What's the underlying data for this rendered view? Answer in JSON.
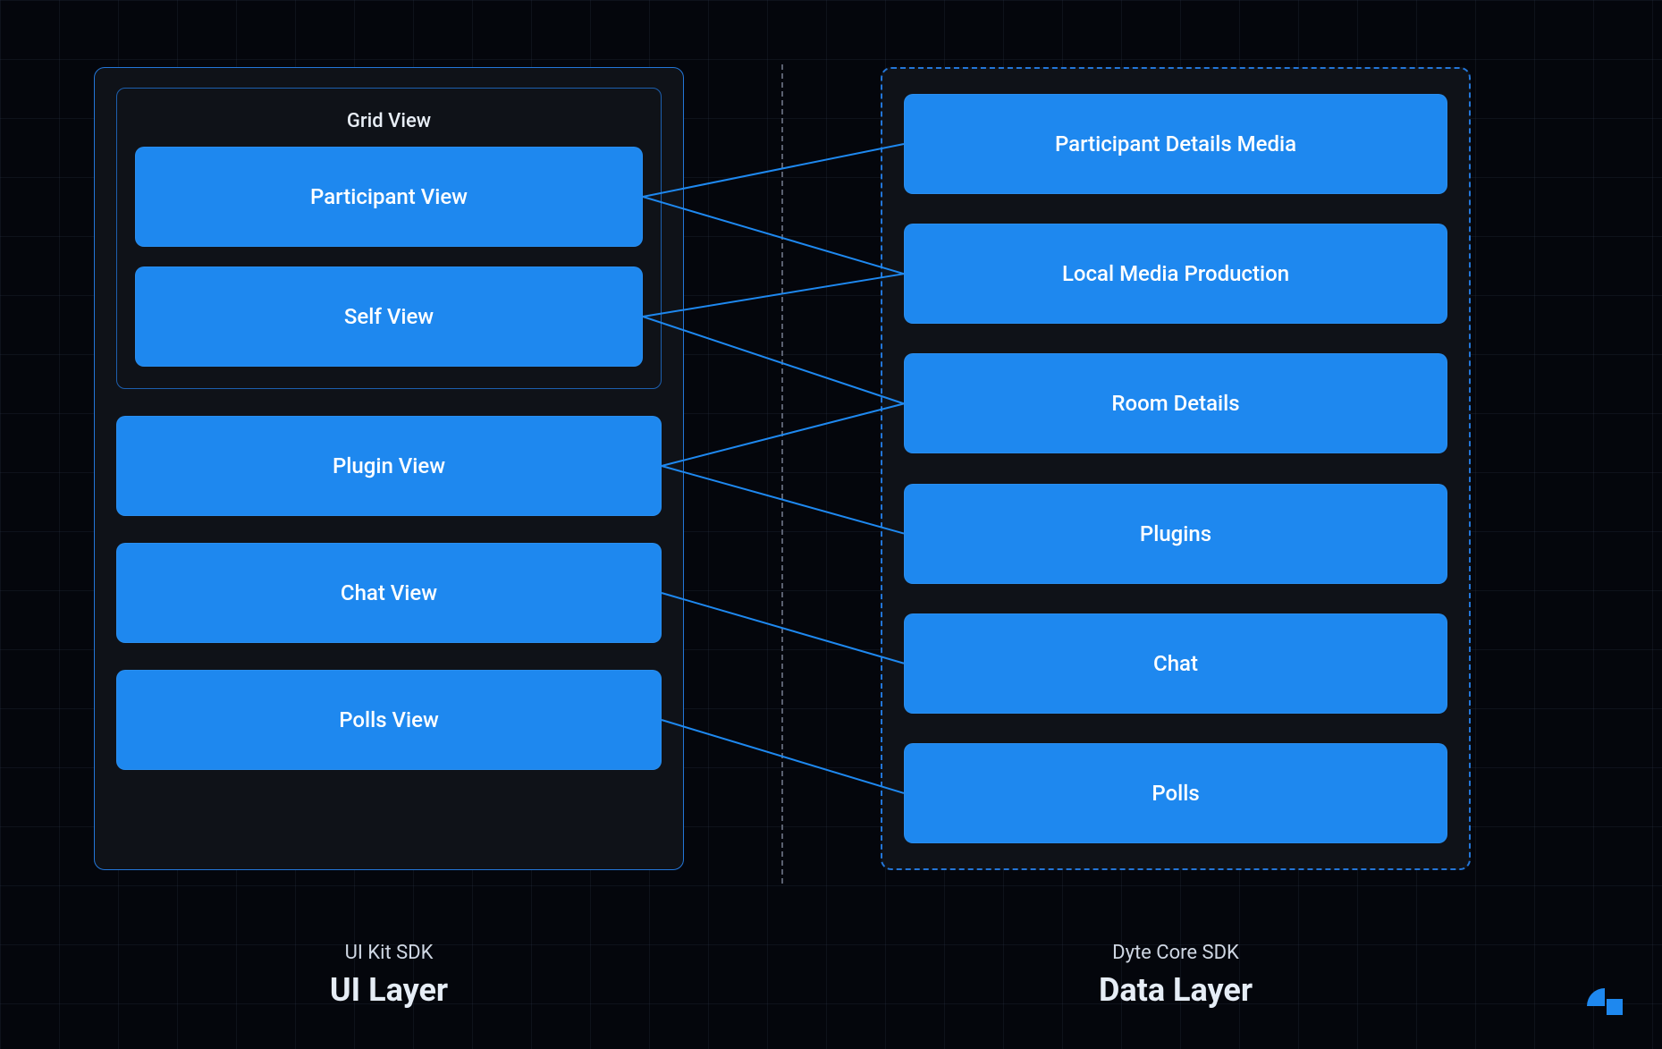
{
  "left": {
    "grid_title": "Grid View",
    "grid_items": [
      "Participant View",
      "Self View"
    ],
    "items": [
      "Plugin View",
      "Chat View",
      "Polls View"
    ],
    "footer_sub": "UI Kit SDK",
    "footer_main": "UI Layer"
  },
  "right": {
    "items": [
      "Participant Details Media",
      "Local Media Production",
      "Room Details",
      "Plugins",
      "Chat",
      "Polls"
    ],
    "footer_sub": "Dyte Core SDK",
    "footer_main": "Data Layer"
  },
  "connections": [
    {
      "from": "participant-view",
      "to": [
        "participant-details-media",
        "local-media-production"
      ]
    },
    {
      "from": "self-view",
      "to": [
        "local-media-production",
        "room-details"
      ]
    },
    {
      "from": "plugin-view",
      "to": [
        "room-details",
        "plugins"
      ]
    },
    {
      "from": "chat-view",
      "to": [
        "chat"
      ]
    },
    {
      "from": "polls-view",
      "to": [
        "polls"
      ]
    }
  ],
  "colors": {
    "tile": "#1e88ef",
    "panel_bg": "#0f1218",
    "border": "#2376d8",
    "bg": "#04060c"
  }
}
